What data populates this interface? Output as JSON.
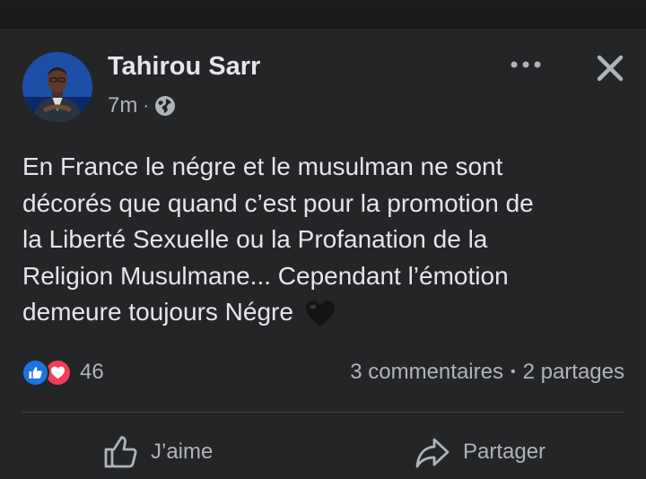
{
  "post": {
    "author": "Tahirou Sarr",
    "time": "7m",
    "separator": "·",
    "privacy_icon": "globe-icon",
    "more_icon": "more-dots-icon",
    "close_icon": "close-icon",
    "text_lines": [
      "En France le négre et le musulman ne sont",
      "décorés que quand c’est pour la promotion de",
      "la Liberté Sexuelle ou la Profanation de la",
      "Religion Musulmane... Cependant l’émotion",
      "demeure toujours Négre"
    ],
    "emoji": "black-heart-icon"
  },
  "reactions": {
    "types": [
      "like-reaction-icon",
      "love-reaction-icon"
    ],
    "count": "46",
    "comments": "3 commentaires",
    "dot": "•",
    "shares": "2 partages"
  },
  "actions": {
    "like_label": "J’aime",
    "share_label": "Partager"
  },
  "colors": {
    "background": "#242526",
    "text": "#e4e6eb",
    "secondary": "#b0b3b8",
    "like_blue": "#1b74e4",
    "love_red": "#f33e58"
  }
}
